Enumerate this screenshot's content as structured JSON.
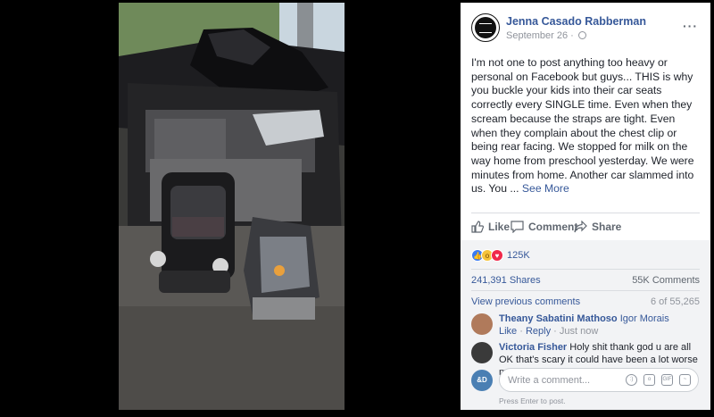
{
  "post": {
    "author": "Jenna Casado Rabberman",
    "date": "September 26",
    "text": "I'm not one to post anything too heavy or personal on Facebook but guys... THIS is why you buckle your kids into their car seats correctly every SINGLE time. Even when they scream because the straps are tight. Even when they complain about the chest clip or being rear facing. We stopped for milk on the way home from preschool yesterday. We were minutes from home. Another car slammed into us. You ... ",
    "see_more": "See More"
  },
  "actions": {
    "like": "Like",
    "comment": "Comment",
    "share": "Share"
  },
  "stats": {
    "reactions_count": "125K",
    "shares": "241,391 Shares",
    "comments": "55K Comments",
    "view_previous": "View previous comments",
    "position": "6 of 55,265"
  },
  "comments": [
    {
      "name": "Theany Sabatini Mathoso",
      "tag": "Igor Morais",
      "text": "",
      "like": "Like",
      "reply": "Reply",
      "time": "Just now"
    },
    {
      "name": "Victoria Fisher",
      "tag": "",
      "text": "Holy shit thank god u are all OK that's scary it could have been a lot worse my"
    }
  ],
  "composer": {
    "avatar_text": "&D",
    "placeholder": "Write a comment...",
    "hint": "Press Enter to post.",
    "icons": [
      "emoji-icon",
      "camera-icon",
      "gif-icon",
      "sticker-icon"
    ]
  },
  "colors": {
    "link": "#365899",
    "muted": "#90949c",
    "like_blue": "#3b7bf2",
    "love_red": "#f0284a",
    "wow_yellow": "#f5c33b"
  }
}
